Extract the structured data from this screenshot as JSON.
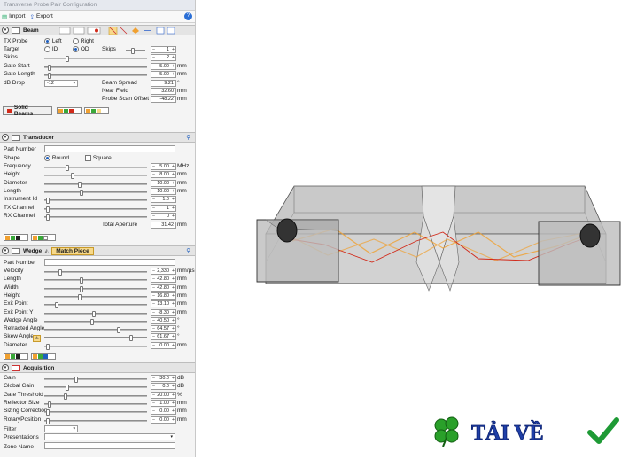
{
  "window": {
    "title": "Transverse Probe Pair Configuration"
  },
  "toolbar": {
    "import_label": "Import",
    "export_label": "Export",
    "help_label": "?"
  },
  "beam": {
    "title": "Beam",
    "tx_probe_label": "TX Probe",
    "tx_left": "Left",
    "tx_right": "Right",
    "target_label": "Target",
    "target_id": "ID",
    "target_od": "OD",
    "skips_label": "Skips",
    "skips_top_label": "Skips",
    "skips_top_value": "1",
    "skips_value": "2",
    "gate_start_label": "Gate Start",
    "gate_start_value": "5.00",
    "gate_length_label": "Gate Length",
    "gate_length_value": "5.00",
    "db_drop_label": "dB Drop",
    "db_drop_value": "-12",
    "beam_spread_label": "Beam Spread",
    "beam_spread_value": "9.21",
    "beam_spread_unit": "°",
    "near_field_label": "Near Field",
    "near_field_value": "32.60",
    "probe_scan_offset_label": "Probe Scan Offset",
    "probe_scan_offset_value": "-48.22",
    "solid_beams_label": "Solid Beams",
    "unit_mm": "mm"
  },
  "transducer": {
    "title": "Transducer",
    "part_number_label": "Part Number",
    "shape_label": "Shape",
    "shape_round": "Round",
    "shape_square": "Square",
    "rows": [
      {
        "label": "Frequency",
        "value": "5.00",
        "unit": "MHz"
      },
      {
        "label": "Height",
        "value": "8.00",
        "unit": "mm"
      },
      {
        "label": "Diameter",
        "value": "10.00",
        "unit": "mm"
      },
      {
        "label": "Length",
        "value": "10.00",
        "unit": "mm"
      },
      {
        "label": "Instrument Id",
        "value": "1.0",
        "unit": ""
      },
      {
        "label": "TX Channel",
        "value": "1",
        "unit": ""
      },
      {
        "label": "RX Channel",
        "value": "0",
        "unit": ""
      }
    ],
    "total_aperture_label": "Total Aperture",
    "total_aperture_value": "31.42",
    "total_aperture_unit": "mm"
  },
  "wedge": {
    "title": "Wedge",
    "match_piece_label": "Match Piece",
    "part_number_label": "Part Number",
    "rows": [
      {
        "label": "Velocity",
        "value": "2,330",
        "unit": "mm/µs"
      },
      {
        "label": "Length",
        "value": "42.80",
        "unit": "mm"
      },
      {
        "label": "Width",
        "value": "42.80",
        "unit": "mm"
      },
      {
        "label": "Height",
        "value": "16.80",
        "unit": "mm"
      },
      {
        "label": "Exit Point",
        "value": "13.10",
        "unit": "mm"
      },
      {
        "label": "Exit Point Y",
        "value": "-8.30",
        "unit": "mm"
      },
      {
        "label": "Wedge Angle",
        "value": "40.50",
        "unit": "°"
      },
      {
        "label": "Refracted Angle",
        "value": "64.57",
        "unit": "°"
      },
      {
        "label": "Skew Angle",
        "value": "61.67",
        "unit": "°"
      },
      {
        "label": "Diameter",
        "value": "0.00",
        "unit": "mm"
      }
    ]
  },
  "acquisition": {
    "title": "Acquisition",
    "rows": [
      {
        "label": "Gain",
        "value": "30.0",
        "unit": "dB"
      },
      {
        "label": "Global Gain",
        "value": "0.0",
        "unit": "dB"
      },
      {
        "label": "Gate Threshold",
        "value": "20.00",
        "unit": "%"
      },
      {
        "label": "Reflector Size",
        "value": "1.00",
        "unit": "mm"
      },
      {
        "label": "Sizing Correction",
        "value": "0.00",
        "unit": "mm"
      },
      {
        "label": "RotaryPosition",
        "value": "0.00",
        "unit": "mm"
      }
    ],
    "filter_label": "Filter",
    "presentations_label": "Presentations",
    "zone_name_label": "Zone Name"
  },
  "watermark": {
    "text": "TẢI VỀ"
  },
  "colors": {
    "accent": "#1f5fbf",
    "match_piece": "#f7d98a",
    "beam_red": "#d12a1a",
    "beam_orange": "#f0a030"
  }
}
